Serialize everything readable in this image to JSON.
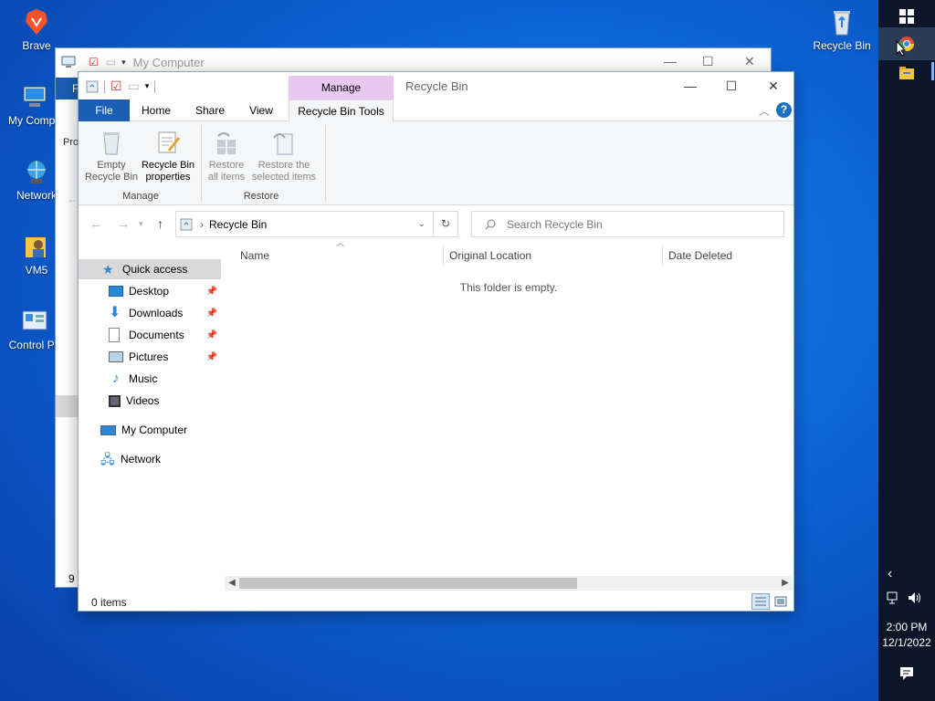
{
  "desktop": {
    "icons": [
      {
        "label": "Brave",
        "icon": "brave-icon"
      },
      {
        "label": "My Compu",
        "icon": "computer-icon"
      },
      {
        "label": "Network",
        "icon": "network-icon"
      },
      {
        "label": "VM5",
        "icon": "user-folder-icon"
      },
      {
        "label": "Control Pa",
        "icon": "control-panel-icon"
      },
      {
        "label": "Recycle Bin",
        "icon": "recycle-bin-icon"
      }
    ]
  },
  "taskbar": {
    "time": "2:00 PM",
    "date": "12/1/2022"
  },
  "back_window": {
    "title": "My Computer",
    "partial_tab": "F",
    "partial_label": "Pro",
    "status_partial": "9 i"
  },
  "window": {
    "title": "Recycle Bin",
    "contextual_tab": "Manage",
    "tabs": [
      "File",
      "Home",
      "Share",
      "View",
      "Recycle Bin Tools"
    ],
    "ribbon": {
      "items": [
        {
          "label1": "Empty",
          "label2": "Recycle Bin"
        },
        {
          "label1": "Recycle Bin",
          "label2": "properties"
        },
        {
          "label1": "Restore",
          "label2": "all items"
        },
        {
          "label1": "Restore the",
          "label2": "selected items"
        }
      ],
      "groups": [
        "Manage",
        "Restore"
      ]
    },
    "address": {
      "path": "Recycle Bin",
      "search_placeholder": "Search Recycle Bin"
    },
    "nav": {
      "quick_access": "Quick access",
      "pinned": [
        "Desktop",
        "Downloads",
        "Documents",
        "Pictures"
      ],
      "others": [
        "Music",
        "Videos"
      ],
      "my_computer": "My Computer",
      "network": "Network"
    },
    "columns": [
      "Name",
      "Original Location",
      "Date Deleted"
    ],
    "empty_message": "This folder is empty.",
    "status": "0 items"
  },
  "colors": {
    "file_tab": "#1a5fb4",
    "manage_tab": "#e8c8f0",
    "taskbar": "#0c1628"
  }
}
